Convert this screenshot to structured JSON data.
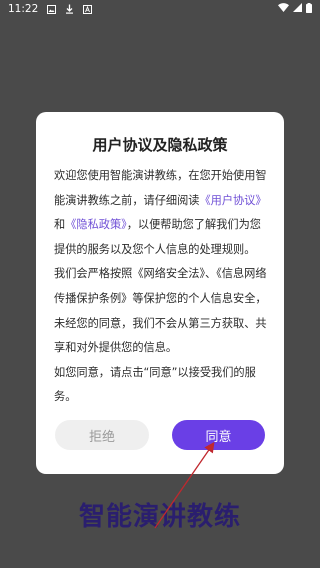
{
  "status_bar": {
    "time": "11:22",
    "left_icons": [
      "image-icon",
      "download-icon",
      "a-badge-icon"
    ],
    "right_icons": [
      "wifi-icon",
      "signal-icon",
      "battery-icon"
    ]
  },
  "dialog": {
    "title": "用户协议及隐私政策",
    "para1_a": "欢迎您使用智能演讲教练，在您开始使用智能演讲教练之前，请仔细阅读",
    "link_user_agreement": "《用户协议》",
    "para1_b": "和",
    "link_privacy_policy": "《隐私政策》",
    "para1_c": "，以便帮助您了解我们为您提供的服务以及您个人信息的处理规则。",
    "para2": "我们会严格按照《网络安全法》、《信息网络传播保护条例》等保护您的个人信息安全，未经您的同意，我们不会从第三方获取、共享和对外提供您的信息。",
    "para3": "如您同意，请点击“同意”以接受我们的服务。"
  },
  "buttons": {
    "reject_label": "拒绝",
    "agree_label": "同意"
  },
  "app_title": "智能演讲教练",
  "colors": {
    "accent": "#6a3fe6",
    "link": "#6f4fd6",
    "scrim": "#4a4a4a",
    "title_text": "#2a1e6e",
    "annotation_arrow": "#c0282e"
  }
}
